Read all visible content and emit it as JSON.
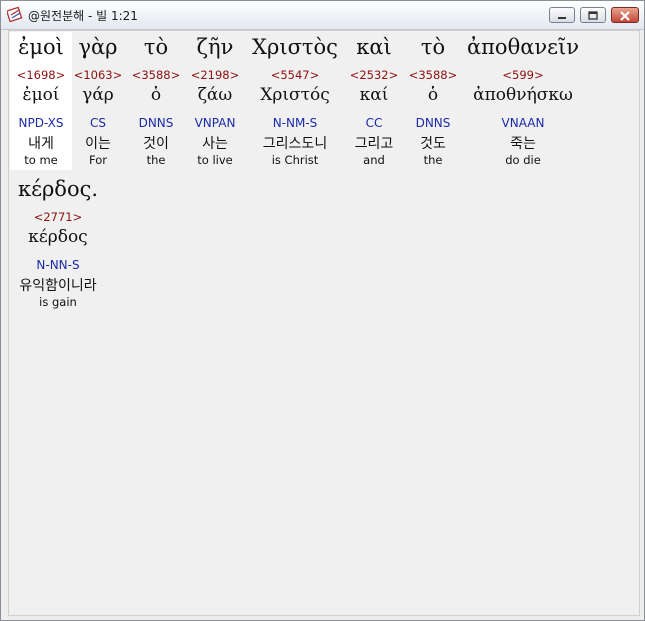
{
  "window": {
    "title": "@원전분해 - 빌 1:21"
  },
  "words": [
    {
      "greek": "ἐμοὶ",
      "strong": "<1698>",
      "lemma": "ἐμοί",
      "parse": "NPD-XS",
      "korean": "내게",
      "english": "to me"
    },
    {
      "greek": "γὰρ",
      "strong": "<1063>",
      "lemma": "γάρ",
      "parse": "CS",
      "korean": "이는",
      "english": "For"
    },
    {
      "greek": "τὸ",
      "strong": "<3588>",
      "lemma": "ὁ",
      "parse": "DNNS",
      "korean": "것이",
      "english": "the"
    },
    {
      "greek": "ζῆν",
      "strong": "<2198>",
      "lemma": "ζάω",
      "parse": "VNPAN",
      "korean": "사는",
      "english": "to live"
    },
    {
      "greek": "Χριστὸς",
      "strong": "<5547>",
      "lemma": "Χριστός",
      "parse": "N-NM-S",
      "korean": "그리스도니",
      "english": "is Christ"
    },
    {
      "greek": "καὶ",
      "strong": "<2532>",
      "lemma": "καί",
      "parse": "CC",
      "korean": "그리고",
      "english": "and"
    },
    {
      "greek": "τὸ",
      "strong": "<3588>",
      "lemma": "ὁ",
      "parse": "DNNS",
      "korean": "것도",
      "english": "the"
    },
    {
      "greek": "ἀποθανεῖν",
      "strong": "<599>",
      "lemma": "ἀποθνήσκω",
      "parse": "VNAAN",
      "korean": "죽는",
      "english": "do die"
    },
    {
      "greek": "κέρδος.",
      "strong": "<2771>",
      "lemma": "κέρδος",
      "parse": "N-NN-S",
      "korean": "유익함이니라",
      "english": "is gain"
    }
  ]
}
